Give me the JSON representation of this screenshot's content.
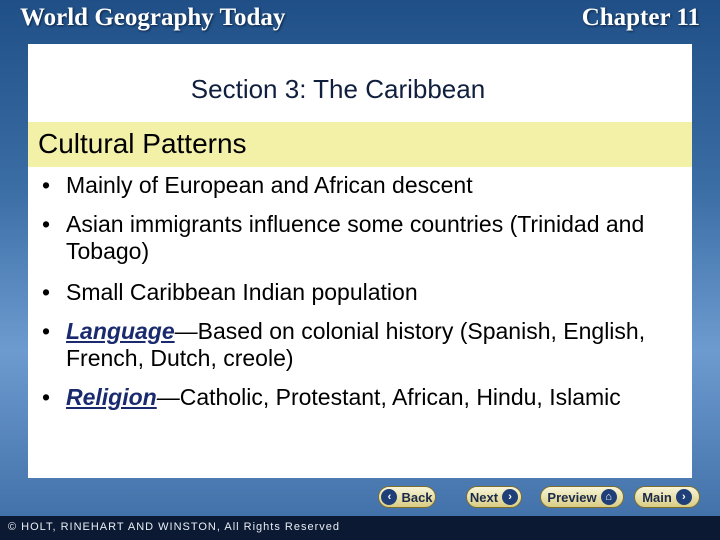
{
  "header": {
    "title": "World Geography Today",
    "chapter": "Chapter 11"
  },
  "slide": {
    "section_title": "Section 3: The Caribbean",
    "band_title": "Cultural Patterns",
    "bullets": [
      {
        "text": "Mainly of European and African descent"
      },
      {
        "text": "Asian immigrants influence some countries (Trinidad and Tobago)"
      },
      {
        "text": "Small Caribbean Indian population"
      },
      {
        "term": "Language",
        "text": "—Based on colonial history (Spanish, English, French, Dutch, creole)"
      },
      {
        "term": "Religion",
        "text": "—Catholic, Protestant, African, Hindu, Islamic"
      }
    ]
  },
  "nav": {
    "back": "Back",
    "next": "Next",
    "preview": "Preview",
    "main": "Main"
  },
  "footer": {
    "copyright": "© HOLT, RINEHART AND WINSTON, All Rights Reserved"
  }
}
